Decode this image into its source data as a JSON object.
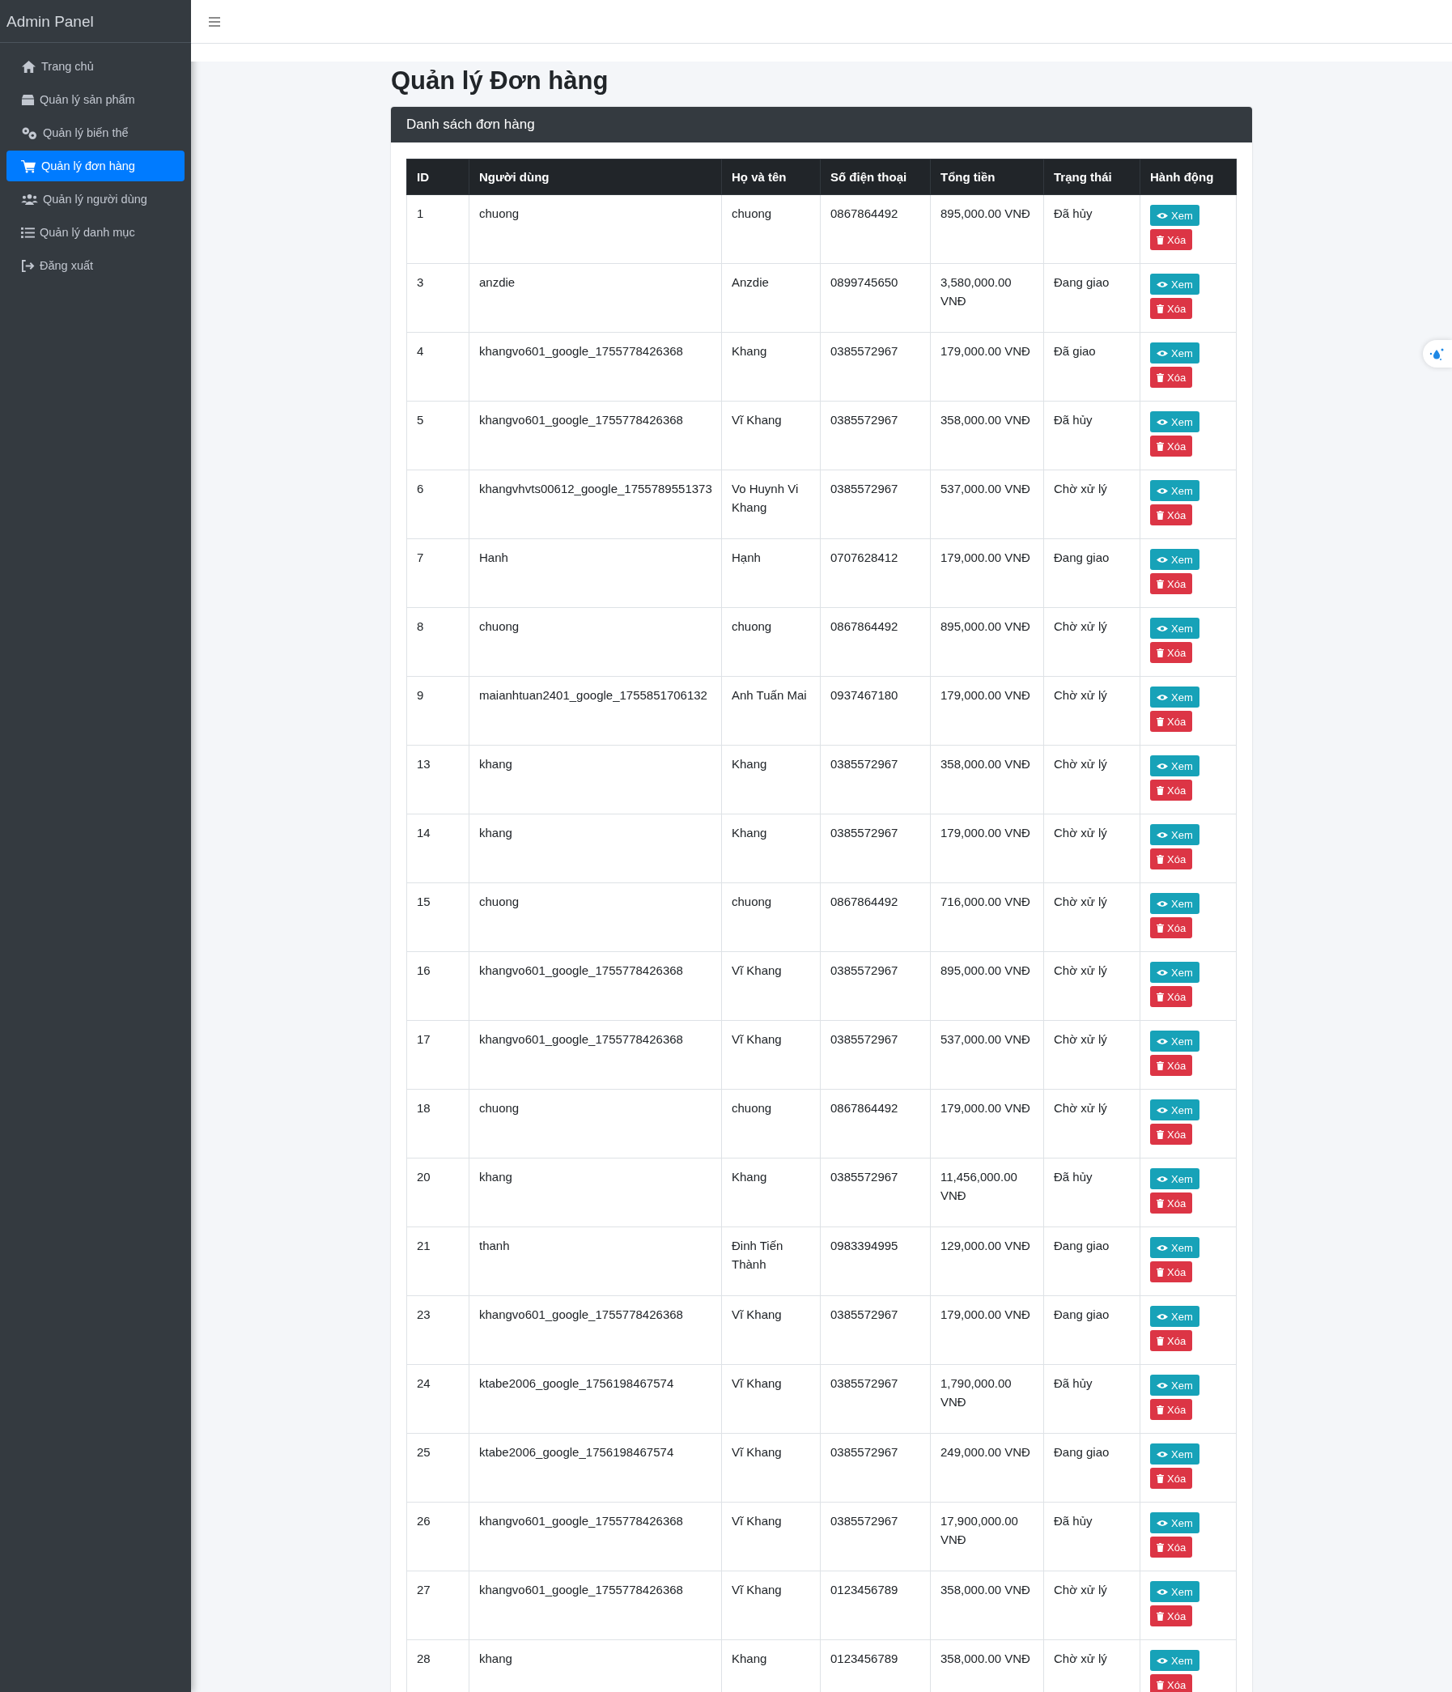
{
  "sidebar": {
    "brand": "Admin Panel",
    "items": [
      {
        "label": "Trang chủ",
        "selected": false
      },
      {
        "label": "Quản lý sản phẩm",
        "selected": false
      },
      {
        "label": "Quản lý biến thể",
        "selected": false
      },
      {
        "label": "Quản lý đơn hàng",
        "selected": true
      },
      {
        "label": "Quản lý người dùng",
        "selected": false
      },
      {
        "label": "Quản lý danh mục",
        "selected": false
      },
      {
        "label": "Đăng xuất",
        "selected": false
      }
    ]
  },
  "page": {
    "title": "Quản lý Đơn hàng"
  },
  "card": {
    "title": "Danh sách đơn hàng"
  },
  "table": {
    "columns": [
      "ID",
      "Người dùng",
      "Họ và tên",
      "Số điện thoại",
      "Tổng tiền",
      "Trạng thái",
      "Hành động"
    ],
    "rows": [
      {
        "cells": [
          "1",
          "chuong",
          "chuong",
          "0867864492",
          "895,000.00 VNĐ",
          "Đã hủy"
        ],
        "view": "Xem",
        "delete": "Xóa"
      },
      {
        "cells": [
          "3",
          "anzdie",
          "Anzdie",
          "0899745650",
          "3,580,000.00 VNĐ",
          "Đang giao"
        ],
        "view": "Xem",
        "delete": "Xóa"
      },
      {
        "cells": [
          "4",
          "khangvo601_google_1755778426368",
          "Khang",
          "0385572967",
          "179,000.00 VNĐ",
          "Đã giao"
        ],
        "view": "Xem",
        "delete": "Xóa"
      },
      {
        "cells": [
          "5",
          "khangvo601_google_1755778426368",
          "Vĩ Khang",
          "0385572967",
          "358,000.00 VNĐ",
          "Đã hủy"
        ],
        "view": "Xem",
        "delete": "Xóa"
      },
      {
        "cells": [
          "6",
          "khangvhvts00612_google_1755789551373",
          "Vo Huynh Vi Khang",
          "0385572967",
          "537,000.00 VNĐ",
          "Chờ xử lý"
        ],
        "view": "Xem",
        "delete": "Xóa"
      },
      {
        "cells": [
          "7",
          "Hanh",
          "Hạnh",
          "0707628412",
          "179,000.00 VNĐ",
          "Đang giao"
        ],
        "view": "Xem",
        "delete": "Xóa"
      },
      {
        "cells": [
          "8",
          "chuong",
          "chuong",
          "0867864492",
          "895,000.00 VNĐ",
          "Chờ xử lý"
        ],
        "view": "Xem",
        "delete": "Xóa"
      },
      {
        "cells": [
          "9",
          "maianhtuan2401_google_1755851706132",
          "Anh Tuấn Mai",
          "0937467180",
          "179,000.00 VNĐ",
          "Chờ xử lý"
        ],
        "view": "Xem",
        "delete": "Xóa"
      },
      {
        "cells": [
          "13",
          "khang",
          "Khang",
          "0385572967",
          "358,000.00 VNĐ",
          "Chờ xử lý"
        ],
        "view": "Xem",
        "delete": "Xóa"
      },
      {
        "cells": [
          "14",
          "khang",
          "Khang",
          "0385572967",
          "179,000.00 VNĐ",
          "Chờ xử lý"
        ],
        "view": "Xem",
        "delete": "Xóa"
      },
      {
        "cells": [
          "15",
          "chuong",
          "chuong",
          "0867864492",
          "716,000.00 VNĐ",
          "Chờ xử lý"
        ],
        "view": "Xem",
        "delete": "Xóa"
      },
      {
        "cells": [
          "16",
          "khangvo601_google_1755778426368",
          "Vĩ Khang",
          "0385572967",
          "895,000.00 VNĐ",
          "Chờ xử lý"
        ],
        "view": "Xem",
        "delete": "Xóa"
      },
      {
        "cells": [
          "17",
          "khangvo601_google_1755778426368",
          "Vĩ Khang",
          "0385572967",
          "537,000.00 VNĐ",
          "Chờ xử lý"
        ],
        "view": "Xem",
        "delete": "Xóa"
      },
      {
        "cells": [
          "18",
          "chuong",
          "chuong",
          "0867864492",
          "179,000.00 VNĐ",
          "Chờ xử lý"
        ],
        "view": "Xem",
        "delete": "Xóa"
      },
      {
        "cells": [
          "20",
          "khang",
          "Khang",
          "0385572967",
          "11,456,000.00 VNĐ",
          "Đã hủy"
        ],
        "view": "Xem",
        "delete": "Xóa"
      },
      {
        "cells": [
          "21",
          "thanh",
          "Đinh Tiến Thành",
          "0983394995",
          "129,000.00 VNĐ",
          "Đang giao"
        ],
        "view": "Xem",
        "delete": "Xóa"
      },
      {
        "cells": [
          "23",
          "khangvo601_google_1755778426368",
          "Vĩ Khang",
          "0385572967",
          "179,000.00 VNĐ",
          "Đang giao"
        ],
        "view": "Xem",
        "delete": "Xóa"
      },
      {
        "cells": [
          "24",
          "ktabe2006_google_1756198467574",
          "Vĩ Khang",
          "0385572967",
          "1,790,000.00 VNĐ",
          "Đã hủy"
        ],
        "view": "Xem",
        "delete": "Xóa"
      },
      {
        "cells": [
          "25",
          "ktabe2006_google_1756198467574",
          "Vĩ Khang",
          "0385572967",
          "249,000.00 VNĐ",
          "Đang giao"
        ],
        "view": "Xem",
        "delete": "Xóa"
      },
      {
        "cells": [
          "26",
          "khangvo601_google_1755778426368",
          "Vĩ Khang",
          "0385572967",
          "17,900,000.00 VNĐ",
          "Đã hủy"
        ],
        "view": "Xem",
        "delete": "Xóa"
      },
      {
        "cells": [
          "27",
          "khangvo601_google_1755778426368",
          "Vĩ Khang",
          "0123456789",
          "358,000.00 VNĐ",
          "Chờ xử lý"
        ],
        "view": "Xem",
        "delete": "Xóa"
      },
      {
        "cells": [
          "28",
          "khang",
          "Khang",
          "0123456789",
          "358,000.00 VNĐ",
          "Chờ xử lý"
        ],
        "view": "Xem",
        "delete": "Xóa"
      }
    ]
  }
}
